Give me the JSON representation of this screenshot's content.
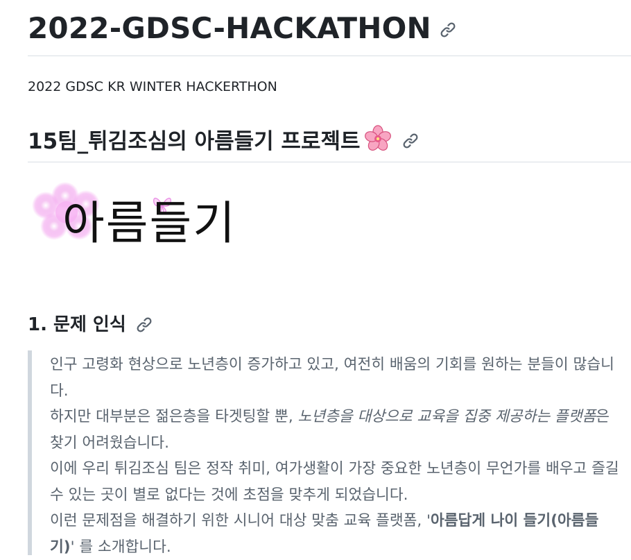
{
  "readme": {
    "title": "2022-GDSC-HACKATHON",
    "subtitle": "2022 GDSC KR WINTER HACKERTHON",
    "project_heading": "15팀_튀김조심의 아름들기 프로젝트",
    "project_emoji": "cherry-blossom-icon",
    "logo_text": "아름들기",
    "section_heading": "1. 문제 인식",
    "quote": {
      "line1": "인구 고령화 현상으로 노년층이 증가하고 있고, 여전히 배움의 기회를 원하는 분들이 많습니다.",
      "line2_before": "하지만 대부분은 젊은층을 타겟팅할 뿐, ",
      "line2_emphasis": "노년층을 대상으로 교육을 집중 제공하는 플랫폼",
      "line2_after": "은 찾기 어려웠습니다.",
      "line3": "이에 우리 튀김조심 팀은 정작 취미, 여가생활이 가장 중요한 노년층이 무언가를 배우고 즐길 수 있는 곳이 별로 없다는 것에 초점을 맞추게 되었습니다.",
      "line4_before": "이런 문제점을 해결하기 위한 시니어 대상 맞춤 교육 플랫폼, '",
      "line4_strong": "아름답게 나이 들기(아름들기)",
      "line4_after": "' 를 소개합니다."
    }
  },
  "colors": {
    "text": "#1f2328",
    "muted": "#59636e",
    "rule": "#d8dee4",
    "quote_border": "#d0d7de",
    "link_icon": "#59636e",
    "blossom": "#f48fb1"
  }
}
